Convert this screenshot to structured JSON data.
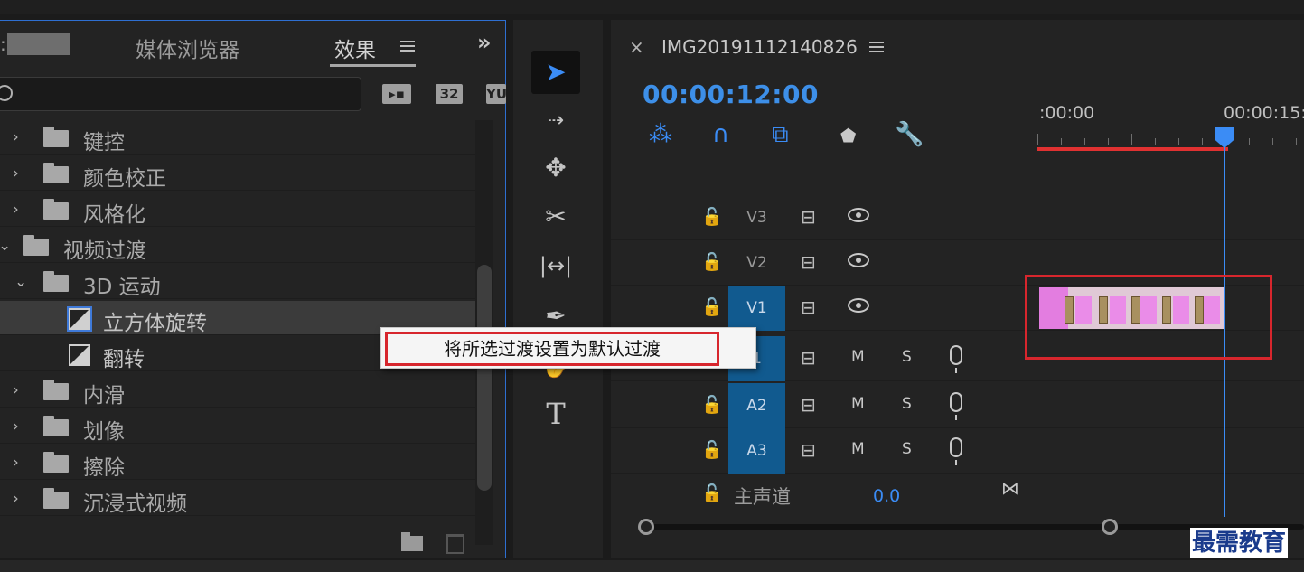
{
  "effects_panel": {
    "tabs": [
      ":",
      "媒体浏览器",
      "效果"
    ],
    "filter_icons": [
      "32",
      "YU"
    ],
    "tree": [
      {
        "label": "键控"
      },
      {
        "label": "颜色校正"
      },
      {
        "label": "风格化"
      },
      {
        "label": "视频过渡"
      },
      {
        "label": "3D 运动"
      },
      {
        "label": "立方体旋转"
      },
      {
        "label": "翻转"
      },
      {
        "label": "内滑"
      },
      {
        "label": "划像"
      },
      {
        "label": "擦除"
      },
      {
        "label": "沉浸式视频"
      }
    ]
  },
  "context_menu": {
    "item": "将所选过渡设置为默认过渡"
  },
  "timeline": {
    "sequence_name": "IMG20191112140826",
    "timecode": "00:00:12:00",
    "ruler_labels": [
      ":00:00",
      "00:00:15:"
    ],
    "tracks": [
      {
        "name": "V3"
      },
      {
        "name": "V2"
      },
      {
        "name": "V1"
      },
      {
        "name": "A1",
        "visible_name": "1"
      },
      {
        "name": "A2"
      },
      {
        "name": "A3"
      }
    ],
    "audio_buttons": {
      "mute": "M",
      "solo": "S"
    },
    "master_label": "主声道",
    "master_value": "0.0"
  },
  "tools": {
    "type_tool": "T"
  },
  "watermark": "最需教育",
  "colors": {
    "accent_blue": "#3b8cf5",
    "highlight_red": "#d7262d",
    "clip_pink": "#e37de0"
  }
}
